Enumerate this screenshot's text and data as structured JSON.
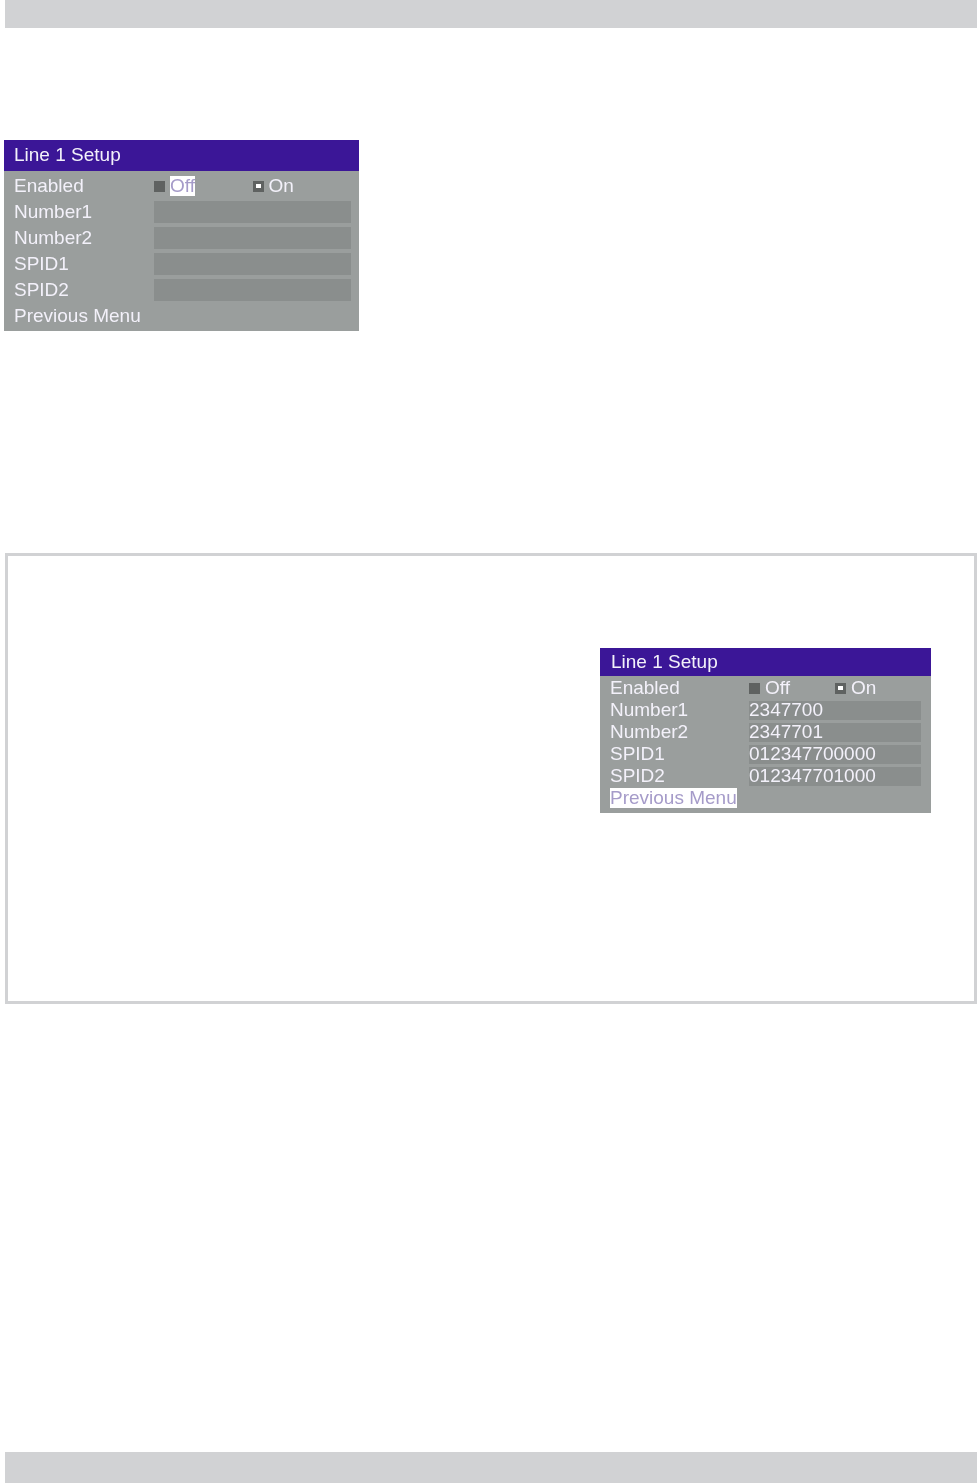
{
  "menus": [
    {
      "title": "Line 1 Setup",
      "enabled": {
        "label": "Enabled",
        "options": [
          {
            "label": "Off",
            "selected": false,
            "focused": true
          },
          {
            "label": "On",
            "selected": true,
            "focused": false
          }
        ]
      },
      "fields": [
        {
          "label": "Number1"
        },
        {
          "label": "Number2"
        },
        {
          "label": "SPID1"
        },
        {
          "label": "SPID2"
        }
      ],
      "previous_menu": {
        "label": "Previous Menu",
        "focused": false
      }
    },
    {
      "title": "Line 1 Setup",
      "enabled": {
        "label": "Enabled",
        "options": [
          {
            "label": "Off",
            "selected": false,
            "focused": false
          },
          {
            "label": "On",
            "selected": true,
            "focused": false
          }
        ]
      },
      "fields": [
        {
          "label": "Number1",
          "value": "2347700"
        },
        {
          "label": "Number2",
          "value": "2347701"
        },
        {
          "label": "SPID1",
          "value": "012347700000"
        },
        {
          "label": "SPID2",
          "value": "012347701000"
        }
      ],
      "previous_menu": {
        "label": "Previous Menu",
        "focused": true
      }
    }
  ]
}
